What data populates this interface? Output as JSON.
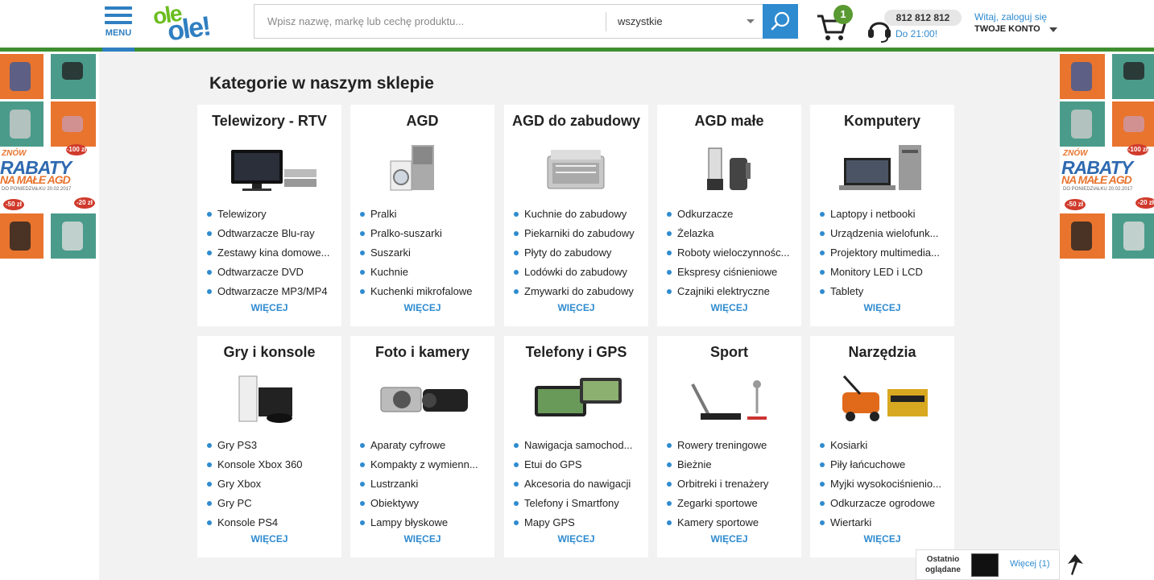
{
  "header": {
    "menu_label": "MENU",
    "logo_top": "ole",
    "logo_bottom": "ole!",
    "search_placeholder": "Wpisz nazwę, markę lub cechę produktu...",
    "search_category": "wszystkie",
    "cart_count": "1",
    "phone_number": "812 812 812",
    "phone_hours": "Do 21:00!",
    "greeting": "Witaj, zaloguj się",
    "account_label": "TWOJE KONTO"
  },
  "banner": {
    "line1": "ZNÓW",
    "line2": "RABATY",
    "line3": "NA MAŁE AGD",
    "date": "DO PONIEDZIAŁKU 20.02.2017",
    "badge1": "-100 zł",
    "badge2": "-50 zł",
    "badge3": "-20 zł"
  },
  "main": {
    "title": "Kategorie w naszym sklepie",
    "more_label": "WIĘCEJ",
    "categories": [
      {
        "title": "Telewizory - RTV",
        "icon": "tv-icon",
        "items": [
          "Telewizory",
          "Odtwarzacze Blu-ray",
          "Zestawy kina domowe...",
          "Odtwarzacze DVD",
          "Odtwarzacze MP3/MP4"
        ]
      },
      {
        "title": "AGD",
        "icon": "washing-machine-icon",
        "items": [
          "Pralki",
          "Pralko-suszarki",
          "Suszarki",
          "Kuchnie",
          "Kuchenki mikrofalowe"
        ]
      },
      {
        "title": "AGD do zabudowy",
        "icon": "dishwasher-icon",
        "items": [
          "Kuchnie do zabudowy",
          "Piekarniki do zabudowy",
          "Płyty do zabudowy",
          "Lodówki do zabudowy",
          "Zmywarki do zabudowy"
        ]
      },
      {
        "title": "AGD małe",
        "icon": "blender-icon",
        "items": [
          "Odkurzacze",
          "Żelazka",
          "Roboty wieloczynnośc...",
          "Ekspresy ciśnieniowe",
          "Czajniki elektryczne"
        ]
      },
      {
        "title": "Komputery",
        "icon": "computer-icon",
        "items": [
          "Laptopy i netbooki",
          "Urządzenia wielofunk...",
          "Projektory multimedia...",
          "Monitory LED i LCD",
          "Tablety"
        ]
      },
      {
        "title": "Gry i konsole",
        "icon": "console-icon",
        "items": [
          "Gry PS3",
          "Konsole Xbox 360",
          "Gry Xbox",
          "Gry PC",
          "Konsole PS4"
        ]
      },
      {
        "title": "Foto i kamery",
        "icon": "camera-icon",
        "items": [
          "Aparaty cyfrowe",
          "Kompakty z wymienn...",
          "Lustrzanki",
          "Obiektywy",
          "Lampy błyskowe"
        ]
      },
      {
        "title": "Telefony i GPS",
        "icon": "gps-icon",
        "items": [
          "Nawigacja samochod...",
          "Etui do GPS",
          "Akcesoria do nawigacji",
          "Telefony i Smartfony",
          "Mapy GPS"
        ]
      },
      {
        "title": "Sport",
        "icon": "treadmill-icon",
        "items": [
          "Rowery treningowe",
          "Bieżnie",
          "Orbitreki i trenażery",
          "Zegarki sportowe",
          "Kamery sportowe"
        ]
      },
      {
        "title": "Narzędzia",
        "icon": "lawnmower-icon",
        "items": [
          "Kosiarki",
          "Piły łańcuchowe",
          "Myjki wysokociśnienio...",
          "Odkurzacze ogrodowe",
          "Wiertarki"
        ]
      }
    ]
  },
  "recent": {
    "label": "Ostatnio oglądane",
    "more": "Więcej (1)"
  },
  "colors": {
    "accent_blue": "#2f8bd0",
    "header_green": "#3e8f2f",
    "background": "#f2f2f2"
  }
}
